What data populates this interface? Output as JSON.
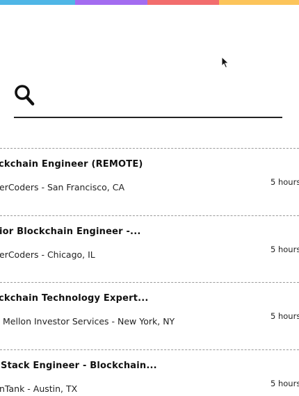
{
  "top_bar": {
    "colors": [
      "#4fb6e6",
      "#a36cf0",
      "#f26d6d",
      "#fcc45a"
    ]
  },
  "search": {
    "value": "",
    "placeholder": "",
    "icon": "search-icon"
  },
  "jobs": [
    {
      "title": "ckchain Engineer (REMOTE)",
      "meta": "erCoders - San Francisco, CA",
      "time": "5 hours"
    },
    {
      "title": "ior Blockchain Engineer -...",
      "meta": "erCoders - Chicago, IL",
      "time": "5 hours"
    },
    {
      "title": "ckchain Technology Expert...",
      "meta": "Mellon Investor Services - New York, NY",
      "time": "5 hours"
    },
    {
      "title": "Stack Engineer - Blockchain...",
      "meta": "nTank - Austin, TX",
      "time": "5 hours"
    }
  ],
  "cursor": {
    "icon": "mouse-pointer-icon"
  }
}
